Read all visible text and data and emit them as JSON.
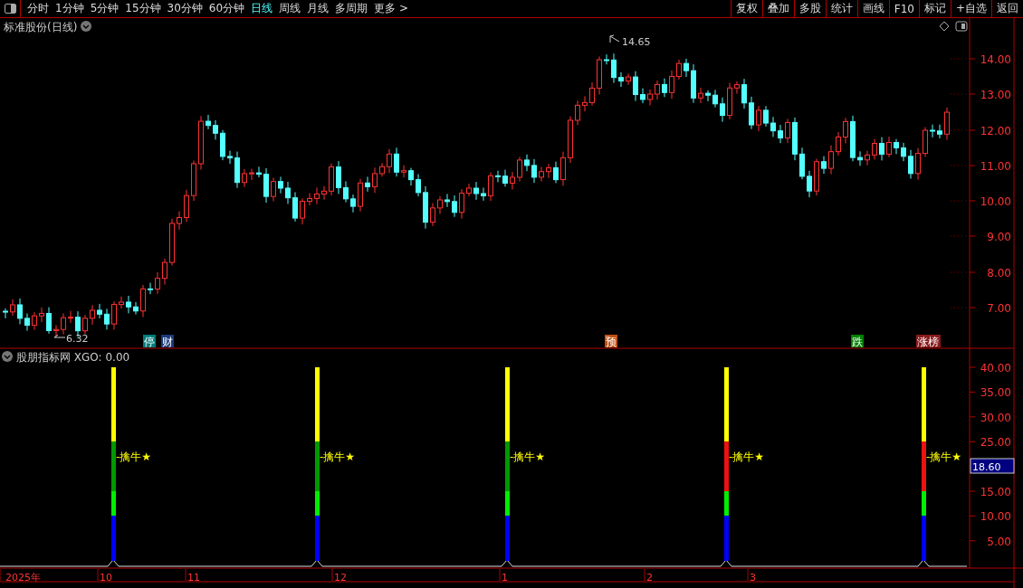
{
  "toolbar": {
    "periods": [
      {
        "label": "分时",
        "selected": false
      },
      {
        "label": "1分钟",
        "selected": false
      },
      {
        "label": "5分钟",
        "selected": false
      },
      {
        "label": "15分钟",
        "selected": false
      },
      {
        "label": "30分钟",
        "selected": false
      },
      {
        "label": "60分钟",
        "selected": false
      },
      {
        "label": "日线",
        "selected": true
      },
      {
        "label": "周线",
        "selected": false
      },
      {
        "label": "月线",
        "selected": false
      },
      {
        "label": "多周期",
        "selected": false
      },
      {
        "label": "更多 >",
        "selected": false
      }
    ],
    "buttons": [
      "复权",
      "叠加",
      "多股",
      "统计",
      "画线",
      "F10",
      "标记",
      "+自选",
      "返回"
    ]
  },
  "main_chart": {
    "title": "标准股份(日线)",
    "price_axis": [
      "14.00",
      "13.00",
      "12.00",
      "11.00",
      "10.00",
      "9.00",
      "8.00",
      "7.00"
    ],
    "high_label": "14.65",
    "low_label": "6.32",
    "markers": [
      {
        "label": "停",
        "color": "#007a7a"
      },
      {
        "label": "财",
        "color": "#1a3a7a"
      },
      {
        "label": "预",
        "color": "#c05010"
      },
      {
        "label": "跌",
        "color": "#008000"
      },
      {
        "label": "涨榜",
        "color": "#8a1a1a"
      }
    ]
  },
  "indicator": {
    "title": "股朋指标网 XGO: 0.00",
    "axis": [
      "40.00",
      "35.00",
      "30.00",
      "25.00",
      "15.00",
      "10.00",
      "5.00"
    ],
    "current_value": "18.60",
    "signals": [
      {
        "label": "-擒牛★",
        "color": "#009900"
      },
      {
        "label": "-擒牛★",
        "color": "#009900"
      },
      {
        "label": "-擒牛★",
        "color": "#009900"
      },
      {
        "label": "-擒牛★",
        "color": "#ee1111"
      },
      {
        "label": "-擒牛★",
        "color": "#ee1111"
      }
    ]
  },
  "date_axis": [
    "2025年",
    "10",
    "11",
    "12",
    "1",
    "2",
    "3"
  ]
}
